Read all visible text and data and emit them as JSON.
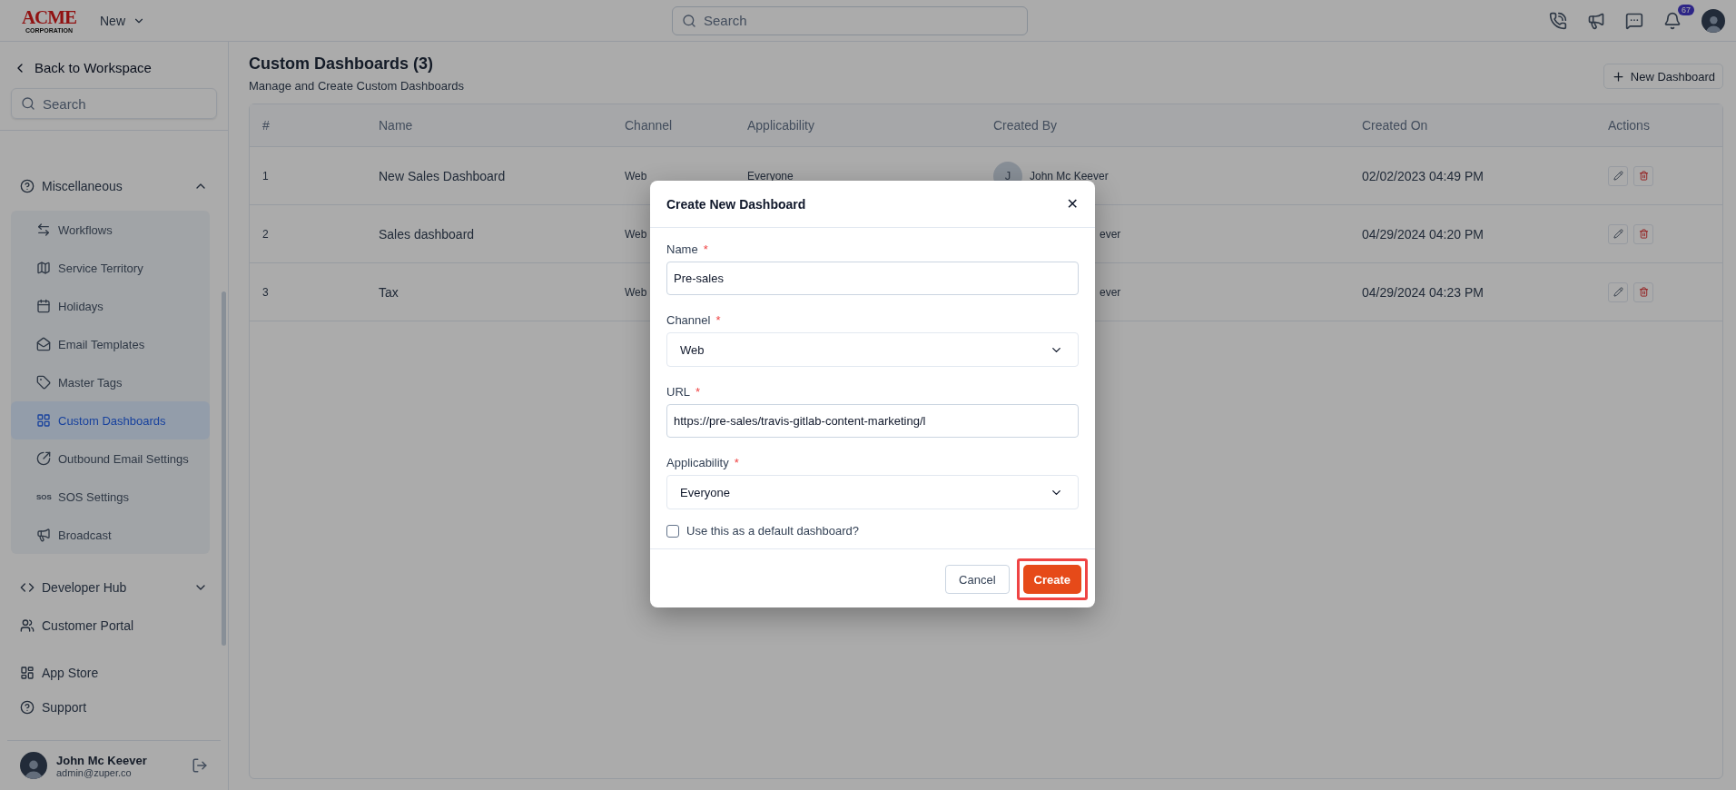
{
  "topbar": {
    "logo_main": "ACME",
    "logo_sub": "CORPORATION",
    "new_menu": "New",
    "search": {
      "placeholder": "Search"
    },
    "notifications": "67"
  },
  "sidebar": {
    "back": "Back to Workspace",
    "search": {
      "placeholder": "Search"
    },
    "sections": [
      {
        "label": "Miscellaneous",
        "expanded": true,
        "children": [
          {
            "label": "Workflows",
            "selected": false
          },
          {
            "label": "Service Territory",
            "selected": false
          },
          {
            "label": "Holidays",
            "selected": false
          },
          {
            "label": "Email Templates",
            "selected": false
          },
          {
            "label": "Master Tags",
            "selected": false
          },
          {
            "label": "Custom Dashboards",
            "selected": true
          },
          {
            "label": "Outbound Email Settings",
            "selected": false
          },
          {
            "label": "SOS Settings",
            "icon_text": "SOS",
            "selected": false
          },
          {
            "label": "Broadcast",
            "selected": false
          }
        ]
      },
      {
        "label": "Developer Hub",
        "expanded": false
      },
      {
        "label": "Customer Portal"
      }
    ],
    "bottom": [
      {
        "label": "App Store"
      },
      {
        "label": "Support"
      }
    ],
    "user": {
      "name": "John Mc Keever",
      "email": "admin@zuper.co"
    }
  },
  "page": {
    "title": "Custom Dashboards (3)",
    "subtitle": "Manage and Create Custom Dashboards",
    "new_button": "New Dashboard"
  },
  "table": {
    "columns": [
      "#",
      "Name",
      "Channel",
      "Applicability",
      "Created By",
      "Created On",
      "Actions"
    ],
    "rows": [
      {
        "index": "1",
        "name": "New Sales Dashboard",
        "channel": "Web",
        "applicability": "Everyone",
        "avatar": "J",
        "created_by": "John Mc Keever",
        "created_on": "02/02/2023 04:49 PM"
      },
      {
        "index": "2",
        "name": "Sales dashboard",
        "channel": "Web",
        "created_by": "ever",
        "created_on": "04/29/2024 04:20 PM"
      },
      {
        "index": "3",
        "name": "Tax",
        "channel": "Web",
        "created_by": "ever",
        "created_on": "04/29/2024 04:23 PM"
      }
    ]
  },
  "modal": {
    "title": "Create New Dashboard",
    "close": "✕",
    "fields": [
      {
        "label": "Name",
        "kind": "text",
        "value": "Pre-sales"
      },
      {
        "label": "Channel",
        "kind": "select",
        "value": "Web"
      },
      {
        "label": "URL",
        "kind": "text",
        "value": "https://pre-sales/travis-gitlab-content-marketing/l"
      },
      {
        "label": "Applicability",
        "kind": "select",
        "value": "Everyone"
      }
    ],
    "required_mark": "*",
    "default_checkbox": {
      "label": "Use this as a default dashboard?",
      "checked": false
    },
    "cancel": "Cancel",
    "create": "Create",
    "create_highlighted": true
  }
}
